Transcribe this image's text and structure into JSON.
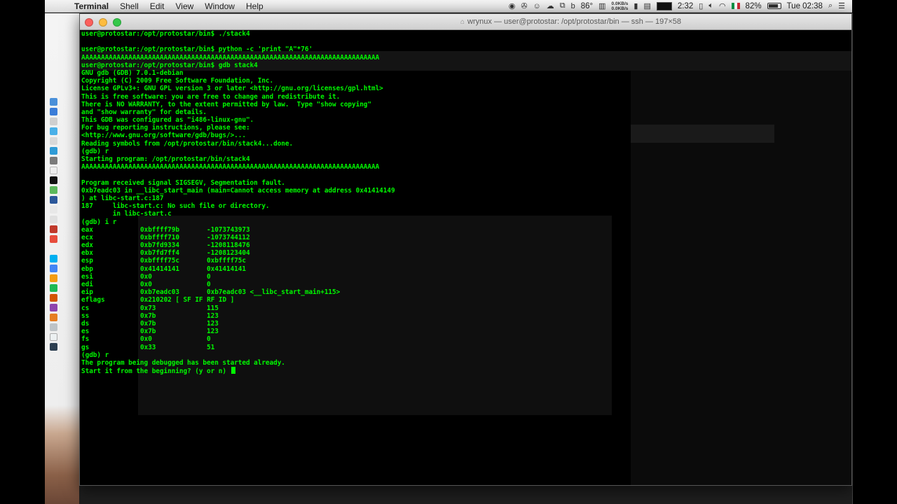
{
  "menubar": {
    "app": "Terminal",
    "menus": [
      "Shell",
      "Edit",
      "View",
      "Window",
      "Help"
    ],
    "temperature": "86°",
    "net_up": "0.0KB/s",
    "net_down": "0.0KB/s",
    "battery_time": "2:32",
    "battery_percent": "82%",
    "battery_level": 0.82,
    "clock": "Tue 02:38"
  },
  "window": {
    "title": "wrynux — user@protostar: /opt/protostar/bin — ssh — 197×58"
  },
  "terminal": {
    "lines": [
      "user@protostar:/opt/protostar/bin$ ./stack4",
      "",
      "user@protostar:/opt/protostar/bin$ python -c 'print \"A\"*76'",
      "AAAAAAAAAAAAAAAAAAAAAAAAAAAAAAAAAAAAAAAAAAAAAAAAAAAAAAAAAAAAAAAAAAAAAAAAAAAA",
      "user@protostar:/opt/protostar/bin$ gdb stack4",
      "GNU gdb (GDB) 7.0.1-debian",
      "Copyright (C) 2009 Free Software Foundation, Inc.",
      "License GPLv3+: GNU GPL version 3 or later <http://gnu.org/licenses/gpl.html>",
      "This is free software: you are free to change and redistribute it.",
      "There is NO WARRANTY, to the extent permitted by law.  Type \"show copying\"",
      "and \"show warranty\" for details.",
      "This GDB was configured as \"i486-linux-gnu\".",
      "For bug reporting instructions, please see:",
      "<http://www.gnu.org/software/gdb/bugs/>...",
      "Reading symbols from /opt/protostar/bin/stack4...done.",
      "(gdb) r",
      "Starting program: /opt/protostar/bin/stack4",
      "AAAAAAAAAAAAAAAAAAAAAAAAAAAAAAAAAAAAAAAAAAAAAAAAAAAAAAAAAAAAAAAAAAAAAAAAAAAA",
      "",
      "Program received signal SIGSEGV, Segmentation fault.",
      "0xb7eadc03 in __libc_start_main (main=Cannot access memory at address 0x41414149",
      ") at libc-start.c:187",
      "187     libc-start.c: No such file or directory.",
      "        in libc-start.c",
      "(gdb) i r"
    ],
    "registers": [
      {
        "name": "eax",
        "hex": "0xbffff79b",
        "value": "-1073743973"
      },
      {
        "name": "ecx",
        "hex": "0xbffff710",
        "value": "-1073744112"
      },
      {
        "name": "edx",
        "hex": "0xb7fd9334",
        "value": "-1208118476"
      },
      {
        "name": "ebx",
        "hex": "0xb7fd7ff4",
        "value": "-1208123404"
      },
      {
        "name": "esp",
        "hex": "0xbffff75c",
        "value": "0xbffff75c"
      },
      {
        "name": "ebp",
        "hex": "0x41414141",
        "value": "0x41414141"
      },
      {
        "name": "esi",
        "hex": "0x0",
        "value": "0"
      },
      {
        "name": "edi",
        "hex": "0x0",
        "value": "0"
      },
      {
        "name": "eip",
        "hex": "0xb7eadc03",
        "value": "0xb7eadc03 <__libc_start_main+115>"
      },
      {
        "name": "eflags",
        "hex": "0x210202 [ SF IF RF ID ]",
        "value": ""
      },
      {
        "name": "cs",
        "hex": "0x73",
        "value": "115"
      },
      {
        "name": "ss",
        "hex": "0x7b",
        "value": "123"
      },
      {
        "name": "ds",
        "hex": "0x7b",
        "value": "123"
      },
      {
        "name": "es",
        "hex": "0x7b",
        "value": "123"
      },
      {
        "name": "fs",
        "hex": "0x0",
        "value": "0"
      },
      {
        "name": "gs",
        "hex": "0x33",
        "value": "51"
      }
    ],
    "after_lines": [
      "(gdb) r",
      "The program being debugged has been started already."
    ],
    "prompt_line": "Start it from the beginning? (y or n) ",
    "colors": {
      "text": "#00f900",
      "background": "#000000"
    }
  }
}
